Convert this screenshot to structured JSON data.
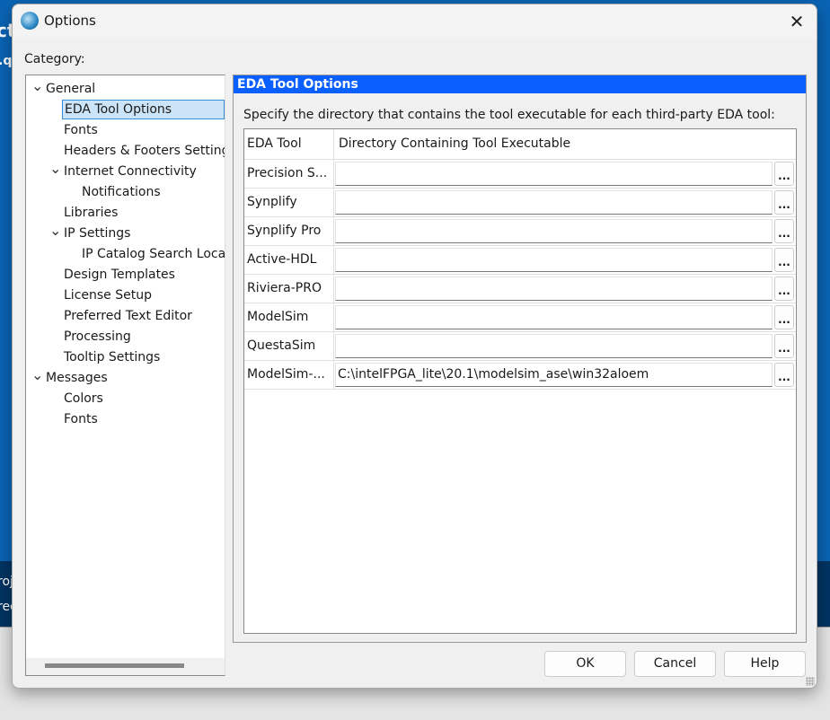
{
  "background": {
    "edge_texts": [
      "cts",
      ".qp",
      "roj",
      "ree"
    ]
  },
  "dialog": {
    "title": "Options",
    "close_label": "✕"
  },
  "category": {
    "label": "Category:",
    "items": [
      {
        "label": "General",
        "level": 0,
        "expanded": true
      },
      {
        "label": "EDA Tool Options",
        "level": 1,
        "selected": true
      },
      {
        "label": "Fonts",
        "level": 1
      },
      {
        "label": "Headers & Footers Settings",
        "level": 1
      },
      {
        "label": "Internet Connectivity",
        "level": 1,
        "expanded": true
      },
      {
        "label": "Notifications",
        "level": 2
      },
      {
        "label": "Libraries",
        "level": 1
      },
      {
        "label": "IP Settings",
        "level": 1,
        "expanded": true
      },
      {
        "label": "IP Catalog Search Locations",
        "level": 2
      },
      {
        "label": "Design Templates",
        "level": 1
      },
      {
        "label": "License Setup",
        "level": 1
      },
      {
        "label": "Preferred Text Editor",
        "level": 1
      },
      {
        "label": "Processing",
        "level": 1
      },
      {
        "label": "Tooltip Settings",
        "level": 1
      },
      {
        "label": "Messages",
        "level": 0,
        "expanded": true
      },
      {
        "label": "Colors",
        "level": 1
      },
      {
        "label": "Fonts",
        "level": 1
      }
    ]
  },
  "panel": {
    "title": "EDA Tool Options",
    "description": "Specify the directory that contains the tool executable for each third-party EDA tool:",
    "columns": [
      "EDA Tool",
      "Directory Containing Tool Executable"
    ],
    "browse_label": "...",
    "rows": [
      {
        "tool": "Precision S...",
        "directory": ""
      },
      {
        "tool": "Synplify",
        "directory": ""
      },
      {
        "tool": "Synplify Pro",
        "directory": ""
      },
      {
        "tool": "Active-HDL",
        "directory": ""
      },
      {
        "tool": "Riviera-PRO",
        "directory": ""
      },
      {
        "tool": "ModelSim",
        "directory": ""
      },
      {
        "tool": "QuestaSim",
        "directory": ""
      },
      {
        "tool": "ModelSim-...",
        "directory": "C:\\intelFPGA_lite\\20.1\\modelsim_ase\\win32aloem"
      }
    ]
  },
  "buttons": {
    "ok": "OK",
    "cancel": "Cancel",
    "help": "Help"
  },
  "colors": {
    "header_blue": "#0a5fff",
    "selection": "#cce4f7",
    "desktop_blue": "#0a64b4"
  }
}
